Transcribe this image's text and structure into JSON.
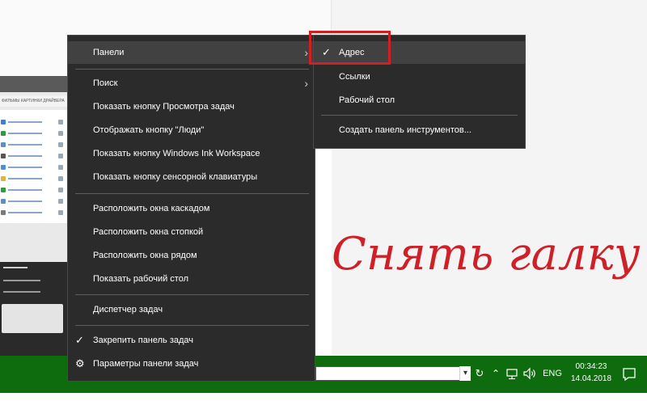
{
  "background": {
    "thumbnail_tabs_text": "ФИЛЬМЫ КАРТИНКИ  ДРАЙВЕРА"
  },
  "context_menu": {
    "items": [
      {
        "label": "Панели",
        "has_submenu": true,
        "highlighted": true
      },
      {
        "label": "Поиск",
        "has_submenu": true
      },
      {
        "label": "Показать кнопку Просмотра задач"
      },
      {
        "label": "Отображать кнопку \"Люди\""
      },
      {
        "label": "Показать кнопку Windows Ink Workspace"
      },
      {
        "label": "Показать кнопку сенсорной клавиатуры"
      },
      {
        "label": "Расположить окна каскадом"
      },
      {
        "label": "Расположить окна стопкой"
      },
      {
        "label": "Расположить окна рядом"
      },
      {
        "label": "Показать рабочий стол"
      },
      {
        "label": "Диспетчер задач"
      },
      {
        "label": "Закрепить панель задач",
        "checked": true
      },
      {
        "label": "Параметры панели задач",
        "icon": "gear-icon"
      }
    ]
  },
  "submenu": {
    "items": [
      {
        "label": "Адрес",
        "checked": true,
        "highlighted": true
      },
      {
        "label": "Ссылки"
      },
      {
        "label": "Рабочий стол"
      },
      {
        "label": "Создать панель инструментов..."
      }
    ],
    "highlight_box_color": "#d21f24"
  },
  "annotation": {
    "text": "Снять галку",
    "color": "#cf2027"
  },
  "taskbar": {
    "color": "#0e6b0e",
    "language": "ENG",
    "time": "00:34:23",
    "date": "14.04.2018"
  },
  "icons": {
    "submenu_arrow": "chevron-right-icon",
    "check": "checkmark-icon",
    "settings": "gear-icon",
    "network": "network-icon",
    "volume": "volume-icon",
    "notifications": "notification-icon",
    "tray_expand": "chevron-up-icon",
    "address_go": "refresh-icon",
    "address_dropdown": "chevron-down-icon"
  }
}
